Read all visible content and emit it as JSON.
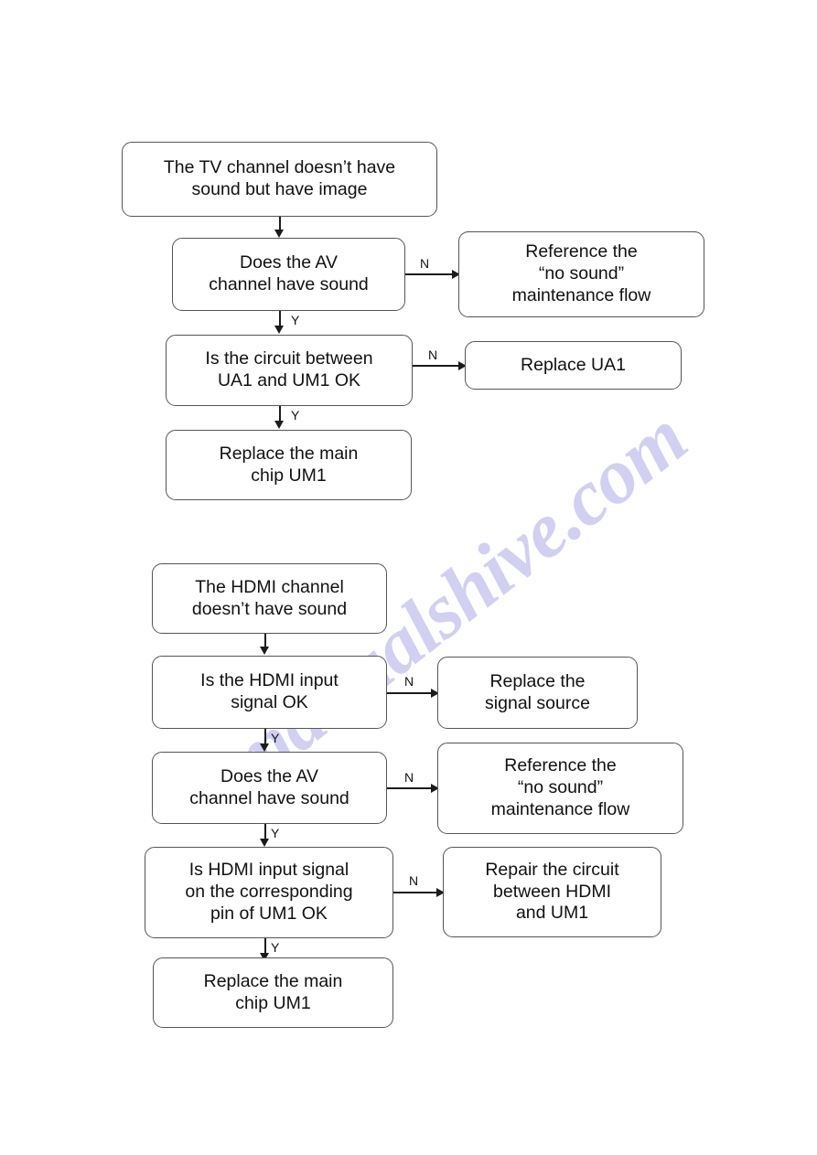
{
  "document": {
    "type": "troubleshooting-flowchart",
    "watermark": "manualshive.com",
    "watermark_color": "#c9c8f0"
  },
  "flowcharts": [
    {
      "id": "tv-no-sound",
      "nodes": [
        {
          "id": "tv-start",
          "label": "The TV channel doesn’t have\nsound but have image"
        },
        {
          "id": "tv-av-check",
          "label": "Does the AV\nchannel have sound"
        },
        {
          "id": "tv-no-sound-ref",
          "label": "Reference the\n“no sound”\nmaintenance flow"
        },
        {
          "id": "tv-circuit",
          "label": "Is the circuit between\nUA1 and UM1 OK"
        },
        {
          "id": "tv-replace-ua1",
          "label": "Replace UA1"
        },
        {
          "id": "tv-replace-um1",
          "label": "Replace the main\nchip UM1"
        }
      ],
      "edges": [
        {
          "from": "tv-start",
          "to": "tv-av-check",
          "label": ""
        },
        {
          "from": "tv-av-check",
          "to": "tv-no-sound-ref",
          "label": "N"
        },
        {
          "from": "tv-av-check",
          "to": "tv-circuit",
          "label": "Y"
        },
        {
          "from": "tv-circuit",
          "to": "tv-replace-ua1",
          "label": "N"
        },
        {
          "from": "tv-circuit",
          "to": "tv-replace-um1",
          "label": "Y"
        }
      ]
    },
    {
      "id": "hdmi-no-sound",
      "nodes": [
        {
          "id": "hdmi-start",
          "label": "The HDMI channel\ndoesn’t have sound"
        },
        {
          "id": "hdmi-input-check",
          "label": "Is the HDMI input\nsignal OK"
        },
        {
          "id": "hdmi-replace-src",
          "label": "Replace the\nsignal source"
        },
        {
          "id": "hdmi-av-check",
          "label": "Does the AV\nchannel have sound"
        },
        {
          "id": "hdmi-no-sound-ref",
          "label": "Reference the\n“no sound”\nmaintenance flow"
        },
        {
          "id": "hdmi-pin-check",
          "label": "Is HDMI input signal\non the corresponding\npin of UM1 OK"
        },
        {
          "id": "hdmi-repair",
          "label": "Repair the circuit\nbetween HDMI\nand UM1"
        },
        {
          "id": "hdmi-replace-um1",
          "label": "Replace the main\nchip UM1"
        }
      ],
      "edges": [
        {
          "from": "hdmi-start",
          "to": "hdmi-input-check",
          "label": ""
        },
        {
          "from": "hdmi-input-check",
          "to": "hdmi-replace-src",
          "label": "N"
        },
        {
          "from": "hdmi-input-check",
          "to": "hdmi-av-check",
          "label": "Y"
        },
        {
          "from": "hdmi-av-check",
          "to": "hdmi-no-sound-ref",
          "label": "N"
        },
        {
          "from": "hdmi-av-check",
          "to": "hdmi-pin-check",
          "label": "Y"
        },
        {
          "from": "hdmi-pin-check",
          "to": "hdmi-repair",
          "label": "N"
        },
        {
          "from": "hdmi-pin-check",
          "to": "hdmi-replace-um1",
          "label": "Y"
        }
      ]
    }
  ],
  "edge_labels": {
    "tv_av_n": "N",
    "tv_av_y": "Y",
    "tv_circuit_n": "N",
    "tv_circuit_y": "Y",
    "hdmi_input_n": "N",
    "hdmi_input_y": "Y",
    "hdmi_av_n": "N",
    "hdmi_av_y": "Y",
    "hdmi_pin_n": "N",
    "hdmi_pin_y": "Y"
  }
}
